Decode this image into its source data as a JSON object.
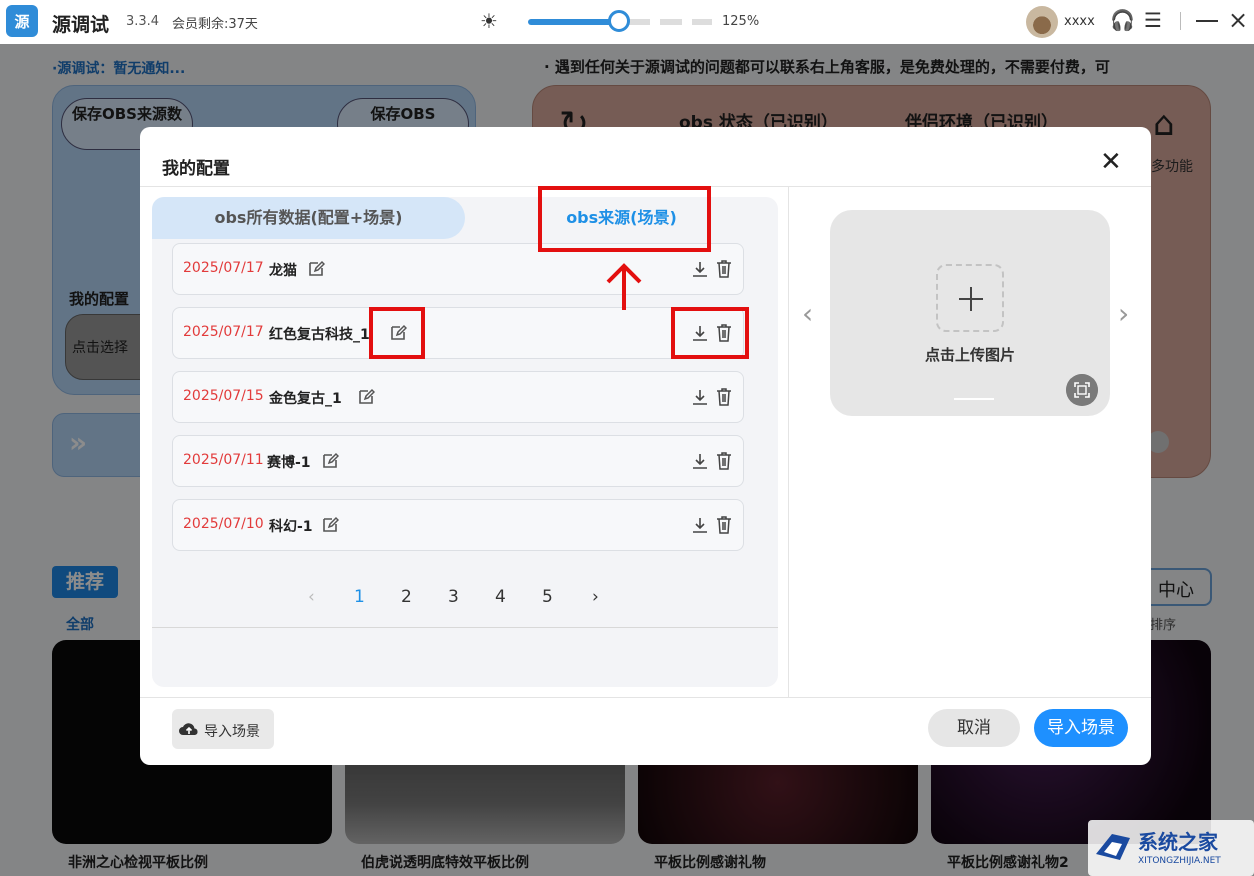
{
  "titlebar": {
    "app_name": "源调试",
    "version": "3.3.4",
    "membership": "会员剩余:37天",
    "zoom": "125%",
    "zoom_fraction": 0.5,
    "username": "xxxx"
  },
  "notices": {
    "left": "·源调试：暂无通知...",
    "right": "· 遇到任何关于源调试的问题都可以联系右上角客服，是免费处理的，不需要付费，可"
  },
  "background": {
    "save_obs_source": "保存OBS来源数",
    "save_obs_2": "保存OBS",
    "my_config": "我的配置",
    "select_placeholder": "点击选择",
    "obs_status": "obs 状态（已识别）",
    "companion_env": "伴侣环境（已识别）",
    "more_features": "多功能",
    "recommend": "推荐",
    "all": "全部",
    "center": "中心",
    "sort": "排序",
    "thumbnails": [
      {
        "label": "非洲之心检视平板比例"
      },
      {
        "label": "伯虎说透明底特效平板比例"
      },
      {
        "label": "平板比例感谢礼物"
      },
      {
        "label": "平板比例感谢礼物2"
      }
    ]
  },
  "modal": {
    "title": "我的配置",
    "tabs": [
      {
        "label": "obs所有数据(配置+场景)",
        "active": false
      },
      {
        "label": "obs来源(场景)",
        "active": true
      }
    ],
    "rows": [
      {
        "date": "2025/07/17",
        "name": "龙猫"
      },
      {
        "date": "2025/07/17",
        "name": "红色复古科技_1"
      },
      {
        "date": "2025/07/15",
        "name": "金色复古_1"
      },
      {
        "date": "2025/07/11",
        "name": "赛博-1"
      },
      {
        "date": "2025/07/10",
        "name": "科幻-1"
      }
    ],
    "pagination": {
      "pages": [
        "1",
        "2",
        "3",
        "4",
        "5"
      ],
      "current": "1"
    },
    "upload_label": "点击上传图片",
    "import_left": "导入场景",
    "cancel": "取消",
    "import": "导入场景"
  },
  "watermark": {
    "text": "系统之家",
    "url": "XITONGZHIJIA.NET"
  },
  "colors": {
    "accent": "#1e90e6",
    "date_red": "#e23b3b",
    "annotation_red": "#e30f0f"
  },
  "icons": [
    "sun-icon",
    "headset-icon",
    "sliders-icon",
    "minimize-icon",
    "close-icon",
    "edit-icon",
    "download-icon",
    "trash-icon",
    "cloud-upload-icon",
    "crop-icon",
    "chevron-left-icon",
    "chevron-right-icon",
    "plus-icon"
  ]
}
